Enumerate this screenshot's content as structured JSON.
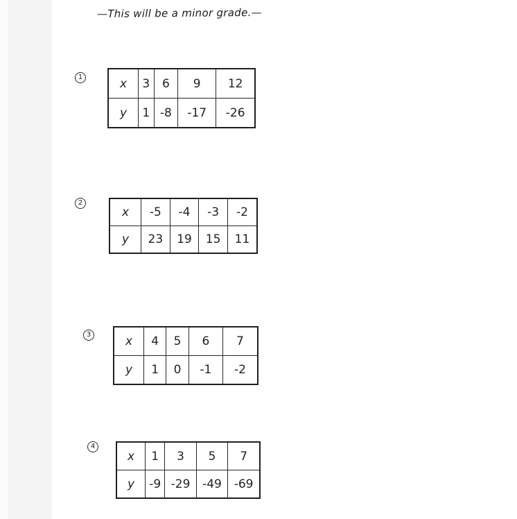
{
  "worksheet": {
    "title": "—This will be a minor grade.—",
    "problems": [
      {
        "number": "1",
        "row_labels": [
          "x",
          "y"
        ],
        "x": [
          "3",
          "6",
          "9",
          "12"
        ],
        "y": [
          "1",
          "-8",
          "-17",
          "-26"
        ]
      },
      {
        "number": "2",
        "row_labels": [
          "x",
          "y"
        ],
        "x": [
          "-5",
          "-4",
          "-3",
          "-2"
        ],
        "y": [
          "23",
          "19",
          "15",
          "11"
        ]
      },
      {
        "number": "3",
        "row_labels": [
          "x",
          "y"
        ],
        "x": [
          "4",
          "5",
          "6",
          "7"
        ],
        "y": [
          "1",
          "0",
          "-1",
          "-2"
        ]
      },
      {
        "number": "4",
        "row_labels": [
          "x",
          "y"
        ],
        "x": [
          "1",
          "3",
          "5",
          "7"
        ],
        "y": [
          "-9",
          "-29",
          "-49",
          "-69"
        ]
      }
    ]
  },
  "colors": {
    "ink": "#222222",
    "left_strip": "#f4f4f4",
    "paper": "#ffffff"
  }
}
